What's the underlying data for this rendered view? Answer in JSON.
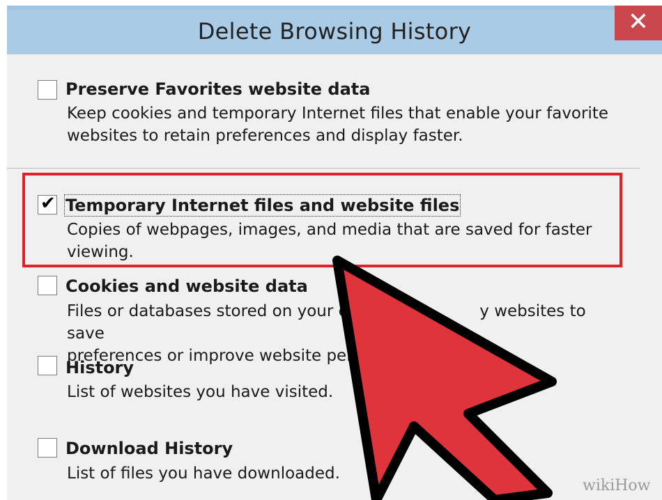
{
  "dialog": {
    "title": "Delete Browsing History",
    "close_glyph": "✕",
    "close_icon": "close-icon"
  },
  "options": [
    {
      "title": "Preserve Favorites website data",
      "desc_line1": "Keep cookies and temporary Internet files that enable your favorite",
      "desc_line2": "websites to retain preferences and display faster.",
      "checked": false
    },
    {
      "title": "Temporary Internet files and website files",
      "desc_line1": "Copies of webpages, images, and media that are saved for faster",
      "desc_line2": "viewing.",
      "checked": true
    },
    {
      "title": "Cookies and website data",
      "desc_line1": "Files or databases stored on your c",
      "desc_line1b": "y websites to save",
      "desc_line2": "preferences or improve website per",
      "checked": false
    },
    {
      "title": "History",
      "desc_line1": "List of websites you have visited.",
      "checked": false
    },
    {
      "title": "Download History",
      "desc_line1": "List of files you have downloaded.",
      "checked": false
    }
  ],
  "check_glyph": "✔",
  "annotation": {
    "highlight_color": "#e0202a",
    "arrow_color": "#e0343c",
    "arrow_icon": "pointer-arrow-icon"
  },
  "watermark": {
    "part1": "wiki",
    "part2": "How"
  }
}
